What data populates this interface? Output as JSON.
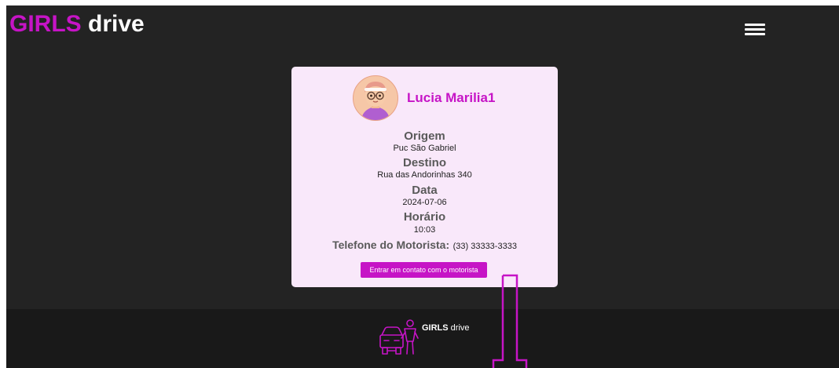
{
  "header": {
    "brand_accent": "GIRLS",
    "brand_rest": " drive",
    "menu_icon": "hamburger-icon"
  },
  "ride_card": {
    "driver_name": "Lucia Marilia1",
    "avatar_icon": "woman-avatar-with-glasses",
    "origin_label": "Origem",
    "origin_value": "Puc São Gabriel",
    "destination_label": "Destino",
    "destination_value": "Rua das Andorinhas 340",
    "date_label": "Data",
    "date_value": "2024-07-06",
    "time_label": "Horário",
    "time_value": "10:03",
    "phone_label": "Telefone do Motorista:",
    "phone_value": "(33) 33333-3333",
    "contact_button": "Entrar em contato com o motorista"
  },
  "footer": {
    "logo_icon": "car-and-woman-logo",
    "brand_bold": "GIRLS",
    "brand_rest": " drive"
  },
  "annotation": {
    "arrow_icon": "down-arrow-outline"
  },
  "colors": {
    "accent": "#c614c6",
    "page_background": "#232323",
    "footer_background": "#191919",
    "card_background": "#f9e8fa"
  }
}
